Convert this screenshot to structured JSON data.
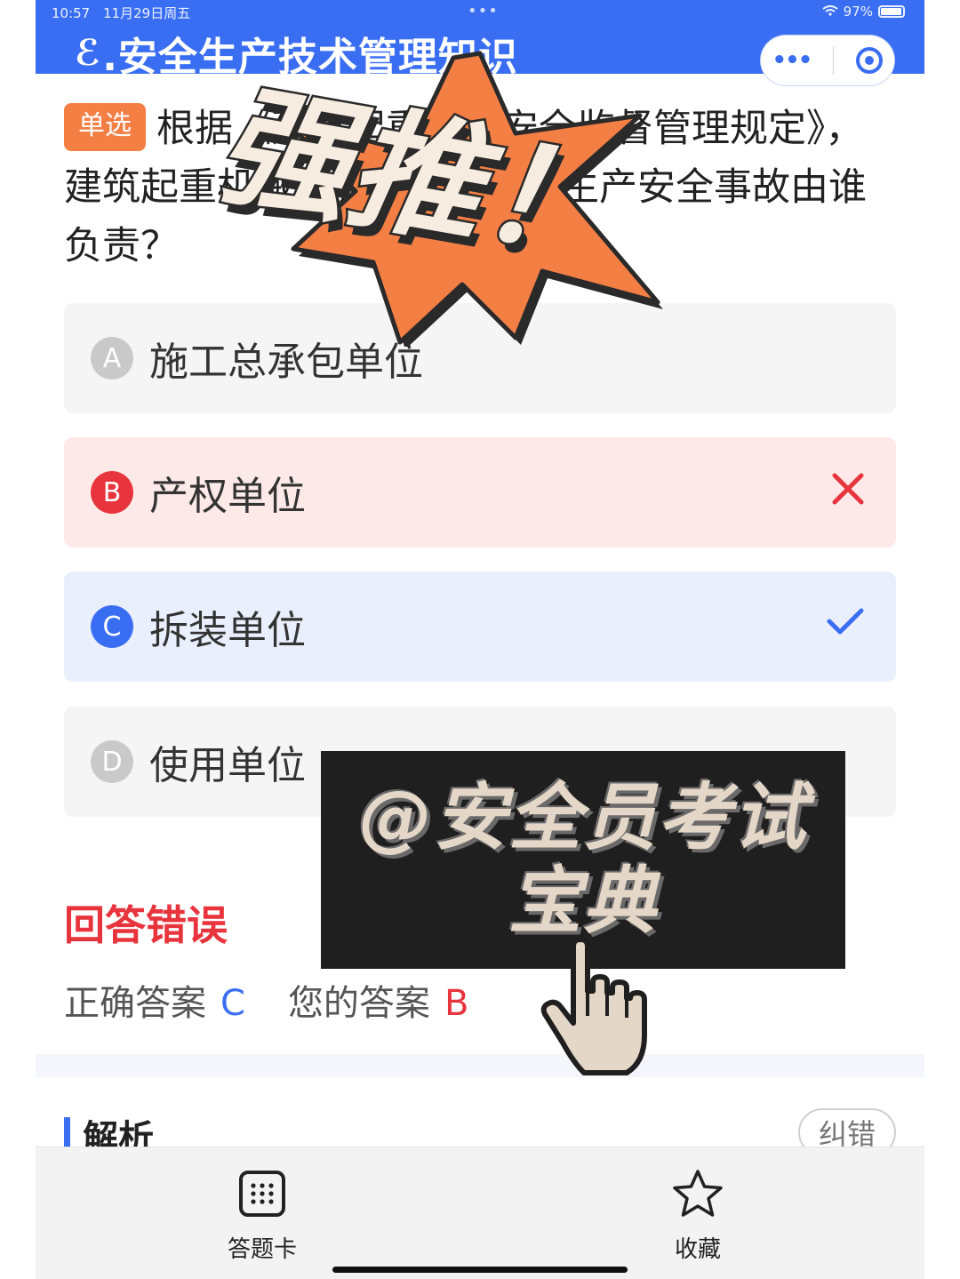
{
  "status_bar": {
    "time": "10:57",
    "date": "11月29日周五",
    "battery": "97%"
  },
  "header": {
    "back_glyph": "ℰ",
    "title": ".安全生产技术管理知识",
    "more_icon": "more-dots-icon",
    "close_icon": "target-icon"
  },
  "question": {
    "type_badge": "单选",
    "text": "根据《建筑起重机械安全监督管理规定》，建筑起重机械安装、拆卸工程生产安全事故由谁负责？"
  },
  "options": [
    {
      "letter": "A",
      "text": "施工总承包单位",
      "state": "normal"
    },
    {
      "letter": "B",
      "text": "产权单位",
      "state": "wrong"
    },
    {
      "letter": "C",
      "text": "拆装单位",
      "state": "correct"
    },
    {
      "letter": "D",
      "text": "使用单位",
      "state": "normal"
    }
  ],
  "result": {
    "status": "回答错误",
    "correct_label": "正确答案",
    "correct_value": "C",
    "your_label": "您的答案",
    "your_value": "B"
  },
  "analysis": {
    "label": "解析",
    "fix_button": "纠错"
  },
  "bottom_nav": [
    {
      "label": "答题卡",
      "icon": "answer-card-grid-icon"
    },
    {
      "label": "收藏",
      "icon": "star-outline-icon"
    }
  ],
  "overlay": {
    "burst_text": "强推！",
    "watermark_line1": "@安全员考试",
    "watermark_line2": "宝典"
  },
  "colors": {
    "primary": "#3a6ef2",
    "wrong": "#e8343c",
    "badge": "#f47f45",
    "burst": "#f47f45",
    "burst_text": "#f7ece0"
  }
}
